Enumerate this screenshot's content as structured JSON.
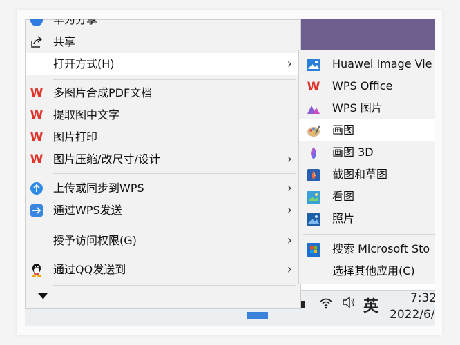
{
  "taskbar": {
    "lang": "英",
    "time": "7:32",
    "date": "2022/6/"
  },
  "menu": {
    "cut_item": "华为分享",
    "items": [
      {
        "label": "共享"
      },
      {
        "label": "打开方式(H)"
      },
      {
        "label": "多图片合成PDF文档"
      },
      {
        "label": "提取图中文字"
      },
      {
        "label": "图片打印"
      },
      {
        "label": "图片压缩/改尺寸/设计"
      },
      {
        "label": "上传或同步到WPS"
      },
      {
        "label": "通过WPS发送"
      },
      {
        "label": "授予访问权限(G)"
      },
      {
        "label": "通过QQ发送到"
      }
    ]
  },
  "submenu": {
    "items": [
      {
        "label": "Huawei Image Vie"
      },
      {
        "label": "WPS Office"
      },
      {
        "label": "WPS 图片"
      },
      {
        "label": "画图"
      },
      {
        "label": "画图 3D"
      },
      {
        "label": "截图和草图"
      },
      {
        "label": "看图"
      },
      {
        "label": "照片"
      },
      {
        "label": "搜索 Microsoft Sto"
      },
      {
        "label": "选择其他应用(C)"
      }
    ]
  },
  "colors": {
    "wps_red": "#e0352b",
    "desktop_purple": "#6e5f8f",
    "highlight": "#ffffff"
  }
}
